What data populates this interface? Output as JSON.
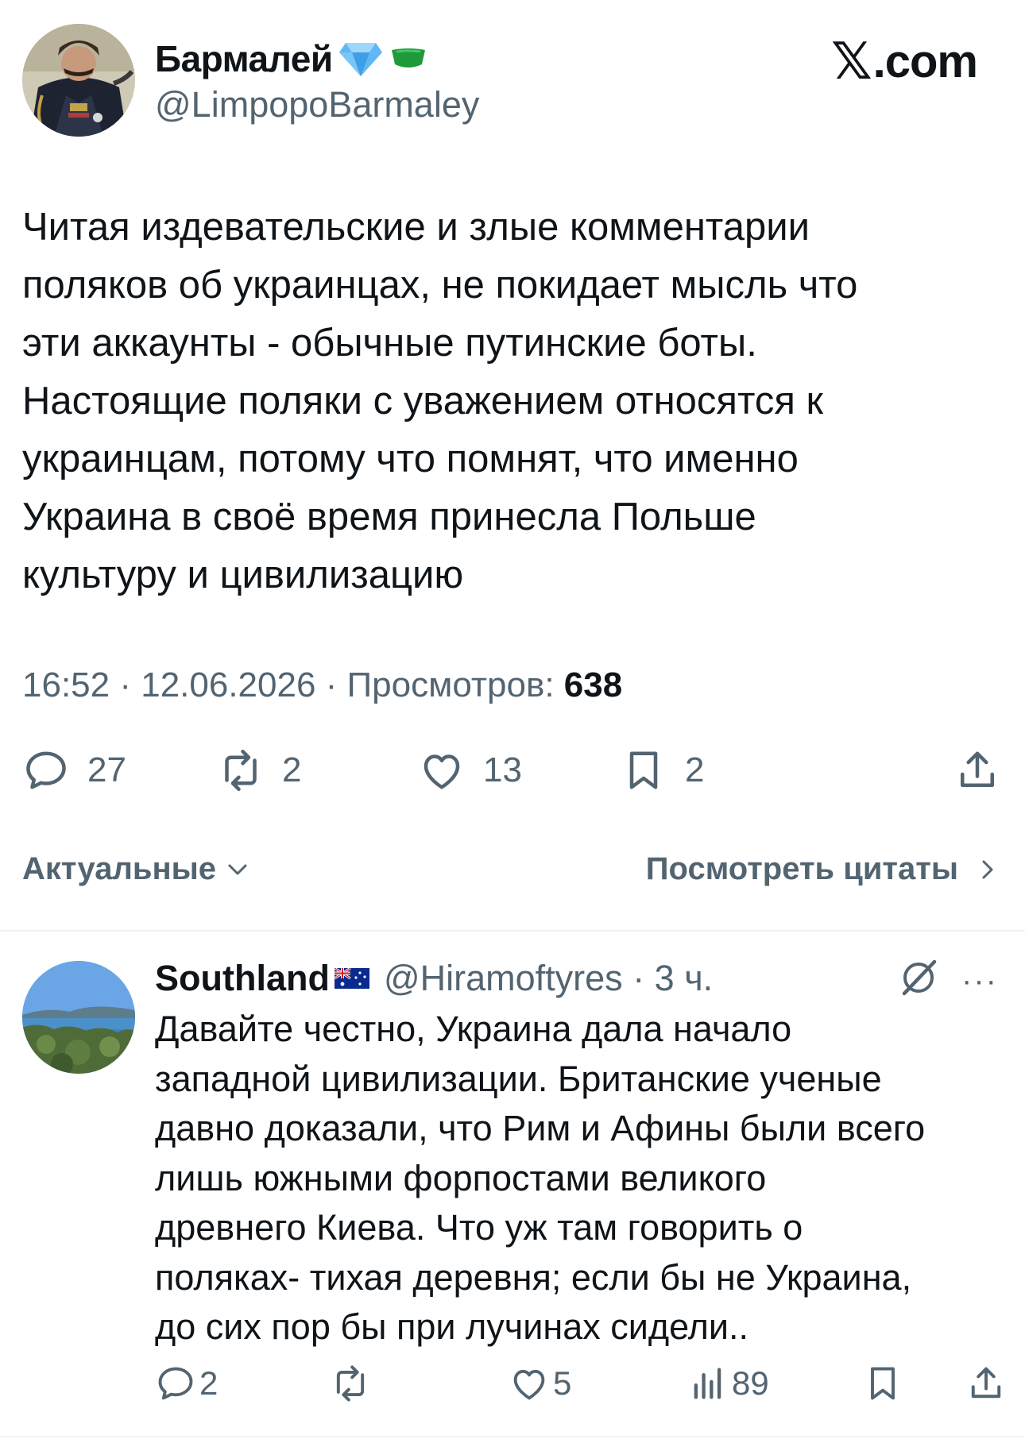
{
  "site_logo": {
    "glyph": "𝕏",
    "text": ".com"
  },
  "tweet": {
    "author_name": "Бармалей",
    "author_handle": "@LimpopoBarmaley",
    "text_lines": [
      "Читая издевательские и злые комментарии",
      "поляков об украинцах, не покидает мысль что",
      "эти аккаунты - обычные путинские боты.",
      "Настоящие поляки с уважением относятся к",
      "украинцам, потому что помнят, что именно",
      "Украина в своё время принесла Польше",
      "культуру и цивилизацию"
    ],
    "time": "16:52",
    "separator": " · ",
    "date": "12.06.2026",
    "views_label": "Просмотров: ",
    "views_count": "638",
    "replies": "27",
    "reposts": "2",
    "likes": "13",
    "bookmarks": "2"
  },
  "sort": {
    "label": "Актуальные",
    "quotes_link": "Посмотреть цитаты"
  },
  "reply": {
    "author_name": "Southland",
    "author_handle": "@Hiramoftyres · 3 ч.",
    "text_lines": [
      "Давайте честно, Украина дала начало",
      "западной цивилизации. Британские ученые",
      "давно доказали, что Рим и Афины были всего",
      "лишь южными форпостами великого",
      "древнего Киева. Что уж там говорить о",
      "поляках- тихая деревня; если бы не Украина,",
      "до сих пор бы при лучинах сидели.."
    ],
    "replies": "2",
    "reposts": "",
    "likes": "5",
    "views": "89",
    "more": "···"
  },
  "colors": {
    "text_primary": "#0f1419",
    "text_secondary": "#536471",
    "verified_diamond": "#5fb8f5",
    "badge_green": "#1f9a3a",
    "divider": "#eff3f4"
  },
  "icons": [
    "diamond-icon",
    "green-badge-icon",
    "reply-icon",
    "repost-icon",
    "like-icon",
    "bookmark-icon",
    "share-icon",
    "chevron-down-icon",
    "chevron-right-icon",
    "australia-flag-icon",
    "grok-icon",
    "more-icon",
    "views-icon"
  ]
}
